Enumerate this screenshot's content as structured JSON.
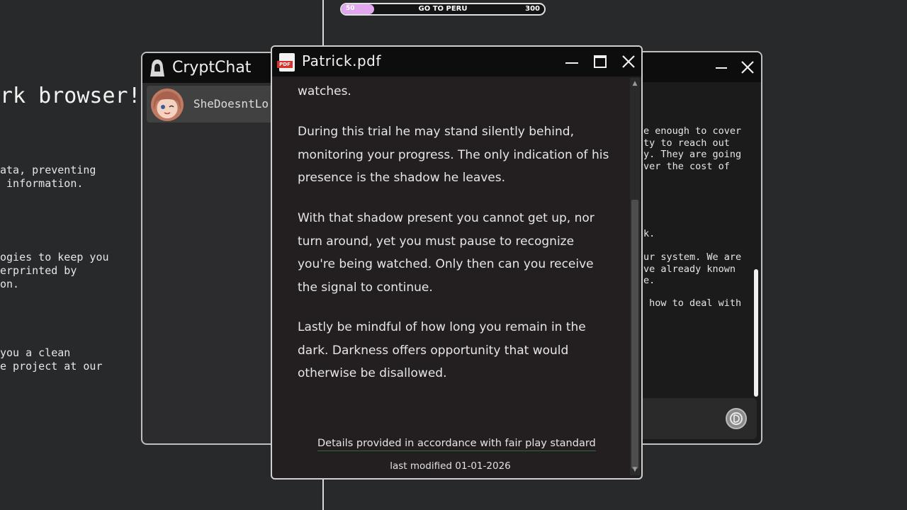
{
  "background_browser": {
    "heading": "rk browser!",
    "paragraphs": [
      "ata, preventing\n information.",
      "ogies to keep you\nerprinted by\non.",
      "you a clean\ne project at our"
    ]
  },
  "progress_bar": {
    "min_label": "50",
    "label": "GO TO PERU",
    "max_label": "300",
    "fill_fraction": 0.16,
    "fill_color": "#e2a8ef"
  },
  "cryptchat": {
    "title": "CryptChat",
    "contact_name": "SheDoesntLo"
  },
  "chat_window": {
    "lines_1": "e enough to cover\nty to reach out\ny. They are going\nver the cost of",
    "lines_2": "k.",
    "lines_3": "ur system. We are\nve already known\ne.",
    "lines_4": " how to deal with"
  },
  "pdf_viewer": {
    "title": "Patrick.pdf",
    "icon_badge": "PDF",
    "paragraphs": [
      "watches.",
      "During this trial he may stand silently behind, monitoring your progress. The only indication of his presence is the shadow he leaves.",
      "With that shadow present you cannot get up, nor turn around, yet you must pause to recognize you're being watched. Only then can you receive the signal to continue.",
      "Lastly be mindful of how long you remain in the dark. Darkness offers opportunity that would otherwise be disallowed."
    ],
    "footer_note": "Details provided in accordance with fair play standard",
    "last_modified": "last modified 01-01-2026"
  }
}
